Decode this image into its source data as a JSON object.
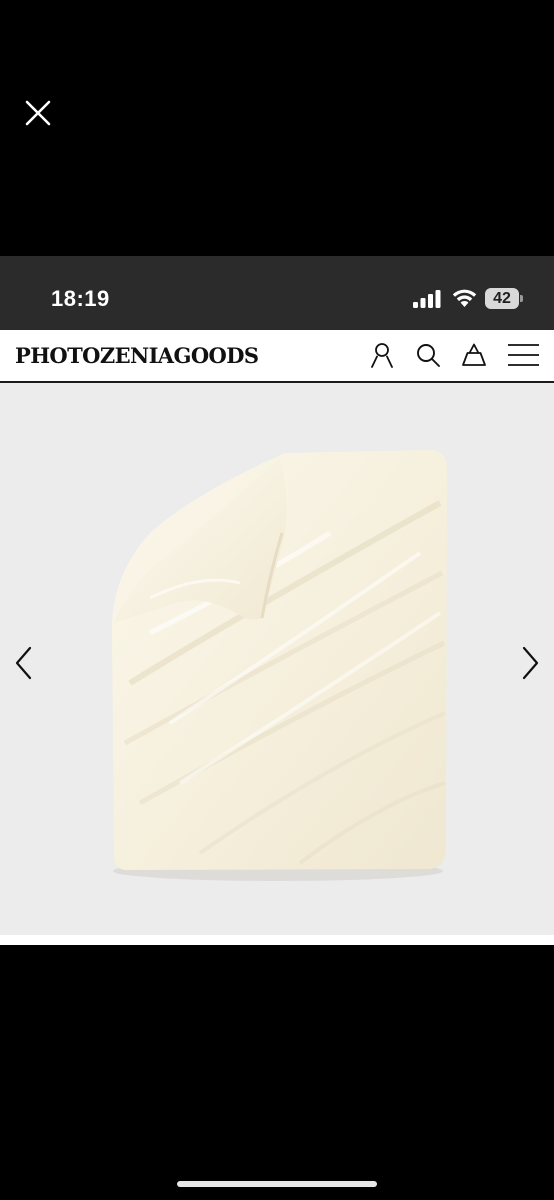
{
  "viewer": {
    "close_icon": "close-icon"
  },
  "status_bar": {
    "time": "18:19",
    "battery_level": "42",
    "icons": [
      "cellular-signal-icon",
      "wifi-icon",
      "battery-icon"
    ]
  },
  "site": {
    "brand": "PHOTOZENIAGOODS",
    "header_icons": [
      "account-icon",
      "search-icon",
      "shopping-bag-icon",
      "menu-icon"
    ]
  },
  "gallery": {
    "image": "cream-duvet-cover-photo",
    "prev_icon": "chevron-left-icon",
    "next_icon": "chevron-right-icon",
    "colors": {
      "background": "#ececec",
      "duvet": "#f6f0de"
    }
  }
}
